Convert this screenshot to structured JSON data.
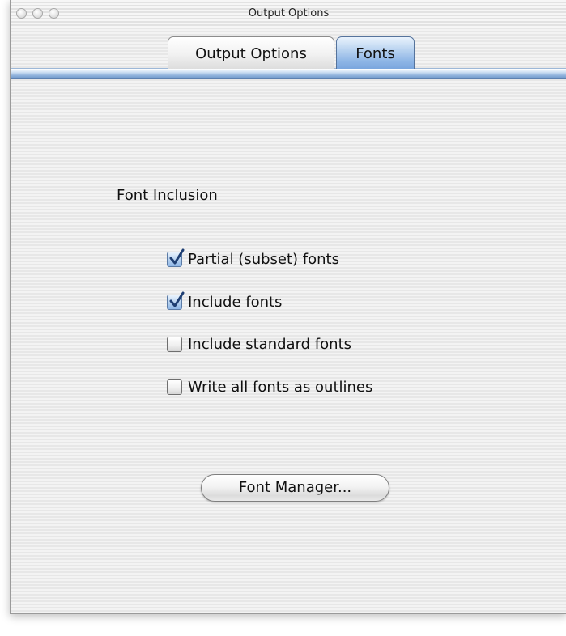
{
  "window": {
    "title": "Output Options"
  },
  "tabs": [
    {
      "label": "Output Options",
      "selected": false
    },
    {
      "label": "Fonts",
      "selected": true
    }
  ],
  "font_inclusion": {
    "heading": "Font Inclusion",
    "options": [
      {
        "label": "Partial (subset) fonts",
        "checked": true
      },
      {
        "label": "Include fonts",
        "checked": true
      },
      {
        "label": "Include standard fonts",
        "checked": false
      },
      {
        "label": "Write all fonts as outlines",
        "checked": false
      }
    ]
  },
  "buttons": {
    "font_manager": "Font Manager..."
  },
  "colors": {
    "accent": "#8fb6e6",
    "checkmark": "#1f3f73"
  },
  "icons": {
    "close": "close-traffic-light-icon",
    "minimize": "minimize-traffic-light-icon",
    "zoom": "zoom-traffic-light-icon",
    "check": "checkmark-icon"
  }
}
